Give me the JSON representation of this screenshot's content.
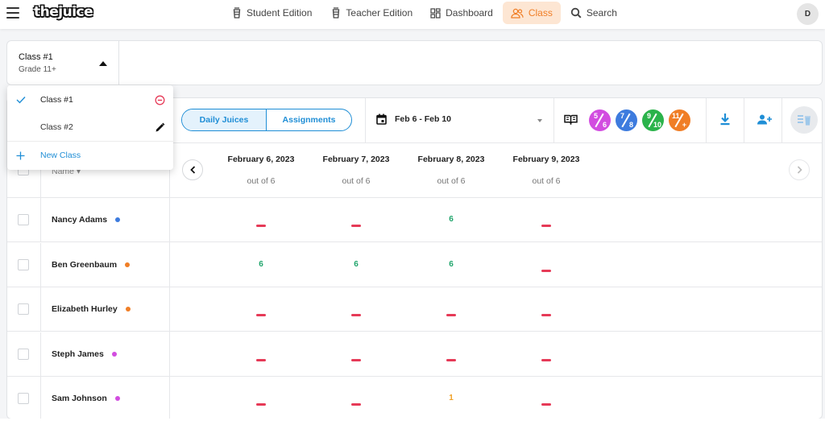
{
  "brand": {
    "logo_text": "thejuice"
  },
  "nav": {
    "items": [
      {
        "label": "Student Edition",
        "icon": "juice-cup-icon",
        "active": false
      },
      {
        "label": "Teacher Edition",
        "icon": "juice-cup-icon",
        "active": false
      },
      {
        "label": "Dashboard",
        "icon": "dashboard-grid-icon",
        "active": false
      },
      {
        "label": "Class",
        "icon": "people-icon",
        "active": true
      },
      {
        "label": "Search",
        "icon": "search-icon",
        "active": false
      }
    ],
    "avatar_initial": "D"
  },
  "class_selector": {
    "name": "Class #1",
    "grade": "Grade 11+"
  },
  "class_dropdown": {
    "items": [
      {
        "label": "Class #1",
        "selected": true,
        "action_icon": "remove-circle-icon"
      },
      {
        "label": "Class #2",
        "selected": false,
        "action_icon": "pencil-icon"
      }
    ],
    "new_label": "New Class"
  },
  "toolbar": {
    "tabs": [
      {
        "label": "Daily Juices",
        "active": true
      },
      {
        "label": "Assignments",
        "active": false
      }
    ],
    "date_range": "Feb 6 - Feb 10",
    "grade_badges": [
      {
        "num": "5",
        "den": "6",
        "color": "#d24de0"
      },
      {
        "num": "7",
        "den": "8",
        "color": "#3d7bde"
      },
      {
        "num": "9",
        "den": "10",
        "color": "#2bb34b"
      },
      {
        "num": "11",
        "den": "+",
        "color": "#f07e26"
      }
    ]
  },
  "table": {
    "name_header": "Name",
    "days": [
      {
        "date": "February 6, 2023",
        "out_of": "out of 6"
      },
      {
        "date": "February 7, 2023",
        "out_of": "out of 6"
      },
      {
        "date": "February 8, 2023",
        "out_of": "out of 6"
      },
      {
        "date": "February 9, 2023",
        "out_of": "out of 6"
      }
    ],
    "students": [
      {
        "name": "Nancy Adams",
        "dot_color": "#3d7bde",
        "scores": [
          "-",
          "-",
          "6",
          "-"
        ]
      },
      {
        "name": "Ben Greenbaum",
        "dot_color": "#f07e26",
        "scores": [
          "6",
          "6",
          "6",
          "-"
        ]
      },
      {
        "name": "Elizabeth Hurley",
        "dot_color": "#f07e26",
        "scores": [
          "-",
          "-",
          "-",
          "-"
        ]
      },
      {
        "name": "Steph James",
        "dot_color": "#d24de0",
        "scores": [
          "-",
          "-",
          "-",
          "-"
        ]
      },
      {
        "name": "Sam Johnson",
        "dot_color": "#d24de0",
        "scores": [
          "-",
          "-",
          "1",
          "-"
        ]
      }
    ]
  },
  "colors": {
    "accent_blue": "#1f8ed6",
    "accent_orange": "#f07e26",
    "missing_red": "#e63a57",
    "score_green": "#1fa46b",
    "score_orange": "#f0a025"
  }
}
